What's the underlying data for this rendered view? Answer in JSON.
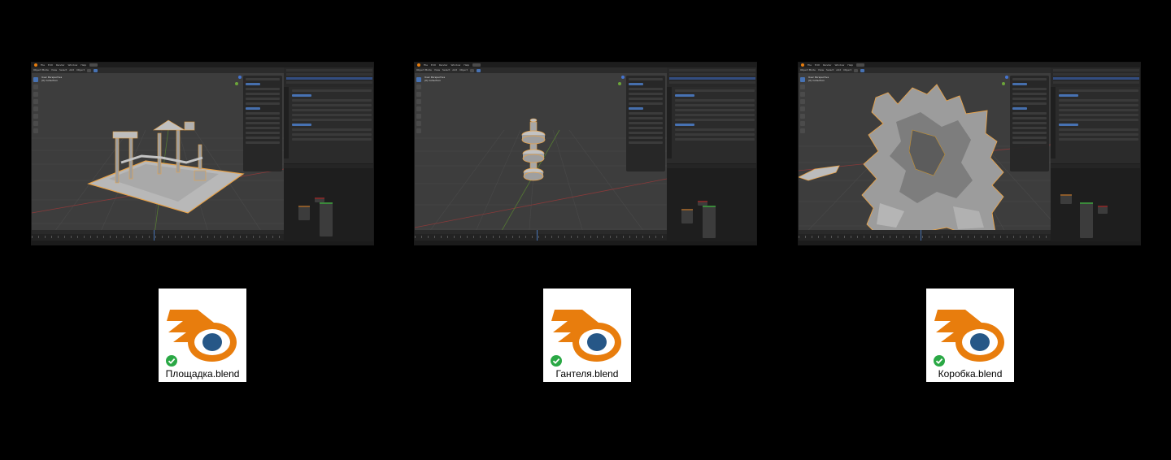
{
  "blender_ui": {
    "menu_items": [
      "File",
      "Edit",
      "Render",
      "Window",
      "Help"
    ],
    "editor_menu": [
      "Object Mode",
      "View",
      "Select",
      "Add",
      "Object"
    ],
    "viewport_info": [
      "User Perspective",
      "(0) Collection"
    ],
    "colors": {
      "window_bg": "#303030",
      "viewport_bg": "#3d3d3d",
      "accent": "#4772b3",
      "selection_outline": "#e8a34a",
      "x_axis": "#d5383a",
      "y_axis": "#6ca53a",
      "z_axis": "#4574cf"
    }
  },
  "screenshots": [
    {
      "scene": "playground",
      "model_color": "#b8b8b8"
    },
    {
      "scene": "dumbbell",
      "model_color": "#b3b3b3"
    },
    {
      "scene": "box",
      "model_color": "#9c9c9c"
    }
  ],
  "files": [
    {
      "name": "Площадка.blend",
      "icon": "blender-logo-icon",
      "status": "synced-check-icon"
    },
    {
      "name": "Гантеля.blend",
      "icon": "blender-logo-icon",
      "status": "synced-check-icon"
    },
    {
      "name": "Коробка.blend",
      "icon": "blender-logo-icon",
      "status": "synced-check-icon"
    }
  ],
  "icon_colors": {
    "blender_orange": "#e87d0d",
    "blender_blue": "#265787",
    "check_green": "#2aa845"
  }
}
